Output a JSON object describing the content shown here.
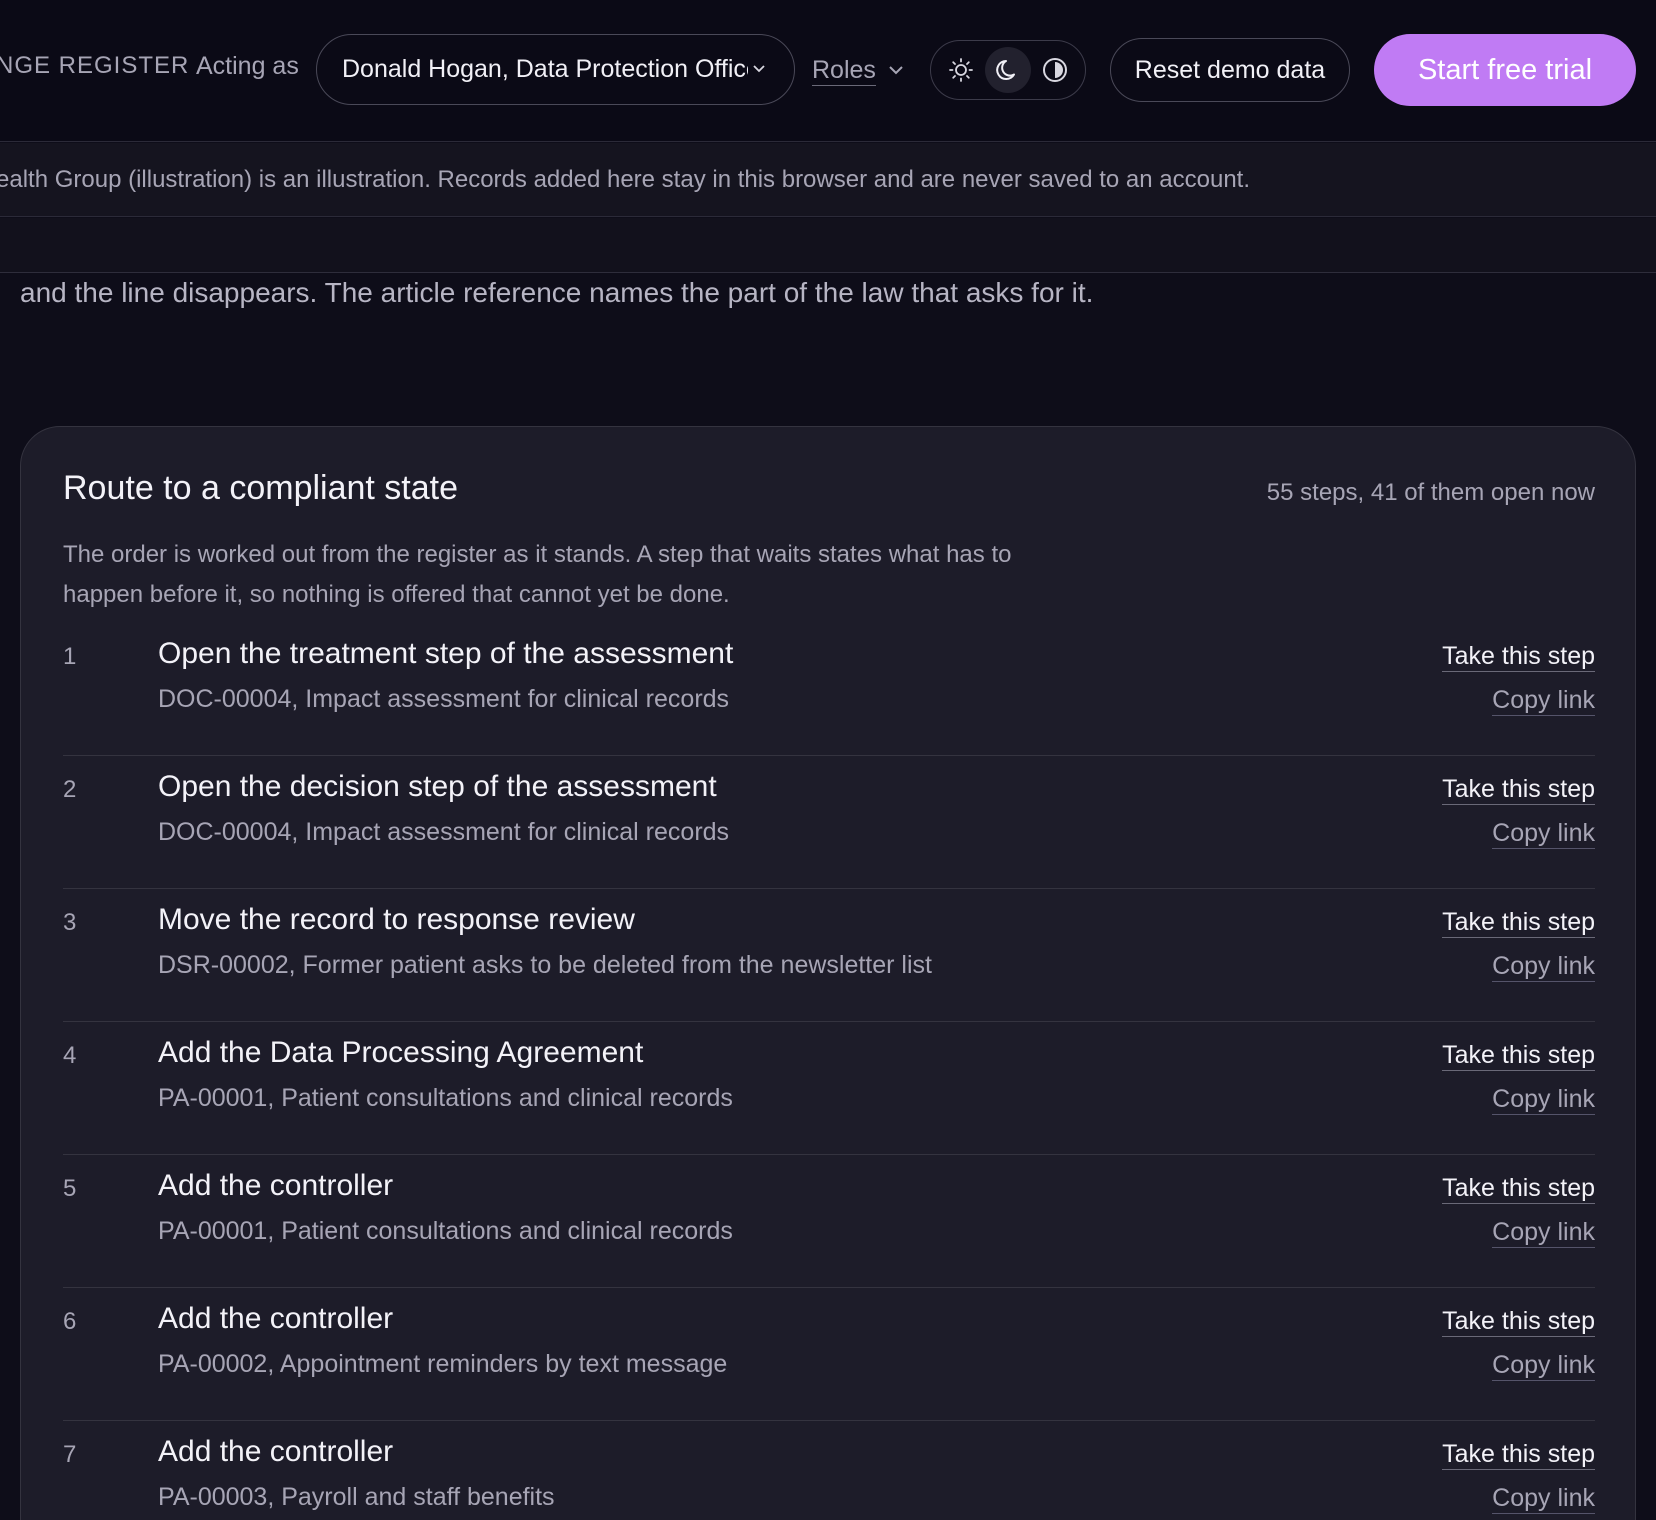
{
  "header": {
    "brand": "NGE REGISTER",
    "acting_label": "Acting as",
    "acting_user": "Donald Hogan, Data Protection Officer",
    "roles_label": "Roles",
    "theme_options": [
      "sun-icon",
      "moon-icon",
      "contrast-icon"
    ],
    "active_theme": "moon-icon",
    "reset_label": "Reset demo data",
    "trial_label": "Start free trial",
    "accent_color": "#c07bf4"
  },
  "notice": {
    "text": "ealth Group (illustration) is an illustration. Records added here stay in this browser and are never saved to an account."
  },
  "intro": {
    "text": "and the line disappears. The article reference names the part of the law that asks for it."
  },
  "route": {
    "title": "Route to a compliant state",
    "count": "55 steps, 41 of them open now",
    "description": "The order is worked out from the register as it stands. A step that waits states what has to happen before it, so nothing is offered that cannot yet be done.",
    "take_label": "Take this step",
    "copy_label": "Copy link",
    "steps": [
      {
        "num": "1",
        "title": "Open the treatment step of the assessment",
        "sub": "DOC-00004, Impact assessment for clinical records"
      },
      {
        "num": "2",
        "title": "Open the decision step of the assessment",
        "sub": "DOC-00004, Impact assessment for clinical records"
      },
      {
        "num": "3",
        "title": "Move the record to response review",
        "sub": "DSR-00002, Former patient asks to be deleted from the newsletter list"
      },
      {
        "num": "4",
        "title": "Add the Data Processing Agreement",
        "sub": "PA-00001, Patient consultations and clinical records"
      },
      {
        "num": "5",
        "title": "Add the controller",
        "sub": "PA-00001, Patient consultations and clinical records"
      },
      {
        "num": "6",
        "title": "Add the controller",
        "sub": "PA-00002, Appointment reminders by text message"
      },
      {
        "num": "7",
        "title": "Add the controller",
        "sub": "PA-00003, Payroll and staff benefits"
      }
    ]
  }
}
